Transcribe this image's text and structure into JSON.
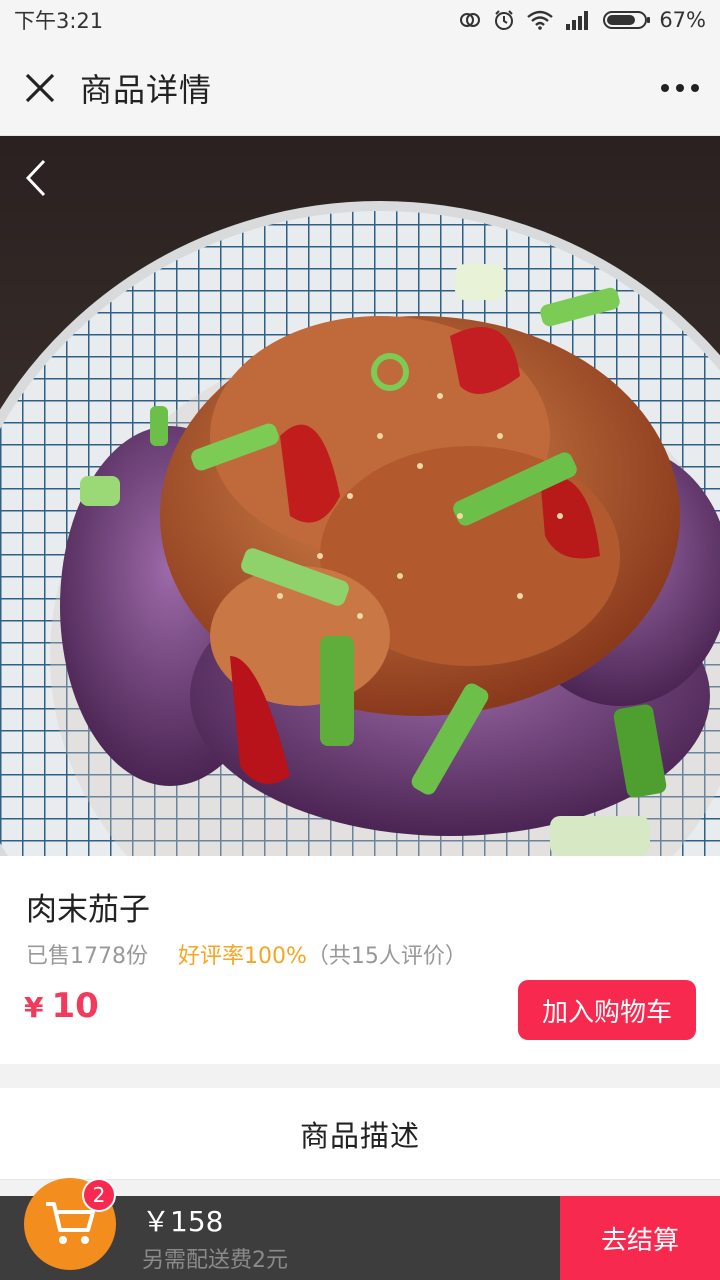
{
  "status_bar": {
    "time": "下午3:21",
    "battery": "67%",
    "icons": [
      "sync-icon",
      "alarm-icon",
      "wifi-icon",
      "signal-icon",
      "battery-icon"
    ]
  },
  "nav": {
    "title": "商品详情",
    "close_icon": "close-icon",
    "more_icon": "more-icon"
  },
  "hero": {
    "back_icon": "chevron-left-icon"
  },
  "product": {
    "name": "肉末茄子",
    "sold": "已售1778份",
    "rating": "好评率100%",
    "rating_count": "（共15人评价）",
    "currency": "¥",
    "price": "10",
    "add_to_cart": "加入购物车"
  },
  "description": {
    "title": "商品描述"
  },
  "bottom_bar": {
    "cart_count": "2",
    "total": "￥158",
    "delivery_note": "另需配送费2元",
    "checkout": "去结算"
  },
  "colors": {
    "accent": "#f7294f",
    "price": "#f23b5c",
    "rating": "#f5a623",
    "cart_button": "#f28d1e",
    "bottom_bar": "#3d3d3d"
  }
}
